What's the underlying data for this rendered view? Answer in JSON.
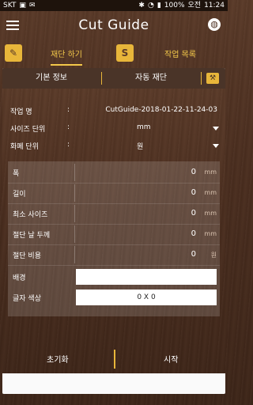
{
  "status_bar": {
    "carrier": "SKT",
    "time_prefix": "오전",
    "time": "11:24",
    "battery": "100%"
  },
  "app": {
    "title": "Cut Guide"
  },
  "tabs": [
    {
      "label": "재단 하기",
      "active": true
    },
    {
      "label": "작업 목록",
      "active": false
    }
  ],
  "panel_header": {
    "info_label": "기본 정보",
    "auto_label": "자동 재단"
  },
  "fields": {
    "job_name_label": "작업 명",
    "job_name_value": "CutGuide-2018-01-22-11-24-03",
    "size_unit_label": "사이즈 단위",
    "size_unit_value": "mm",
    "currency_unit_label": "화폐 단위",
    "currency_unit_value": "원",
    "colon": ":"
  },
  "params": [
    {
      "label": "폭",
      "value": "0",
      "unit": "mm"
    },
    {
      "label": "길이",
      "value": "0",
      "unit": "mm"
    },
    {
      "label": "최소 사이즈",
      "value": "0",
      "unit": "mm"
    },
    {
      "label": "절단 날 두께",
      "value": "0",
      "unit": "mm"
    },
    {
      "label": "절단 비용",
      "value": "0",
      "unit": "원"
    },
    {
      "label": "배경",
      "value": ""
    },
    {
      "label": "글자 색상",
      "value": "0 X 0"
    }
  ],
  "bottom": {
    "reset_label": "초기화",
    "start_label": "시작"
  },
  "colors": {
    "accent": "#e8b63a",
    "wood_dark": "#4b2e1f"
  }
}
